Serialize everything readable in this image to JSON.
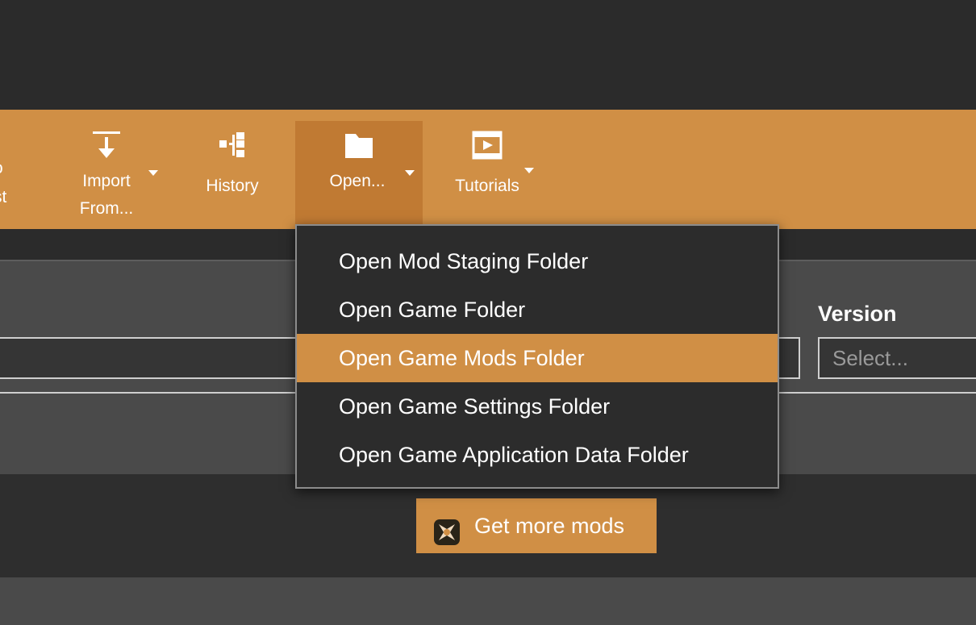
{
  "toolbar": {
    "clipped_item": {
      "line1": "o",
      "line2": "st"
    },
    "import": {
      "line1": "Import",
      "line2": "From...",
      "icon": "import-arrow-icon"
    },
    "history": {
      "label": "History",
      "icon": "history-tree-icon"
    },
    "open": {
      "label": "Open...",
      "icon": "folder-icon"
    },
    "tutorials": {
      "label": "Tutorials",
      "icon": "video-tutorial-icon"
    }
  },
  "open_menu": {
    "items": [
      {
        "label": "Open Mod Staging Folder",
        "highlighted": false
      },
      {
        "label": "Open Game Folder",
        "highlighted": false
      },
      {
        "label": "Open Game Mods Folder",
        "highlighted": true
      },
      {
        "label": "Open Game Settings Folder",
        "highlighted": false
      },
      {
        "label": "Open Game Application Data Folder",
        "highlighted": false
      }
    ]
  },
  "filters": {
    "version_label": "Version",
    "version_placeholder": "Select..."
  },
  "get_more_mods": {
    "label": "Get more mods",
    "icon": "nexus-logo-icon"
  },
  "colors": {
    "accent": "#d08f45",
    "accent_dark": "#c07a33",
    "background": "#2b2b2b",
    "panel": "#4a4a4a",
    "menu_bg": "#2c2c2c",
    "text": "#ffffff"
  }
}
